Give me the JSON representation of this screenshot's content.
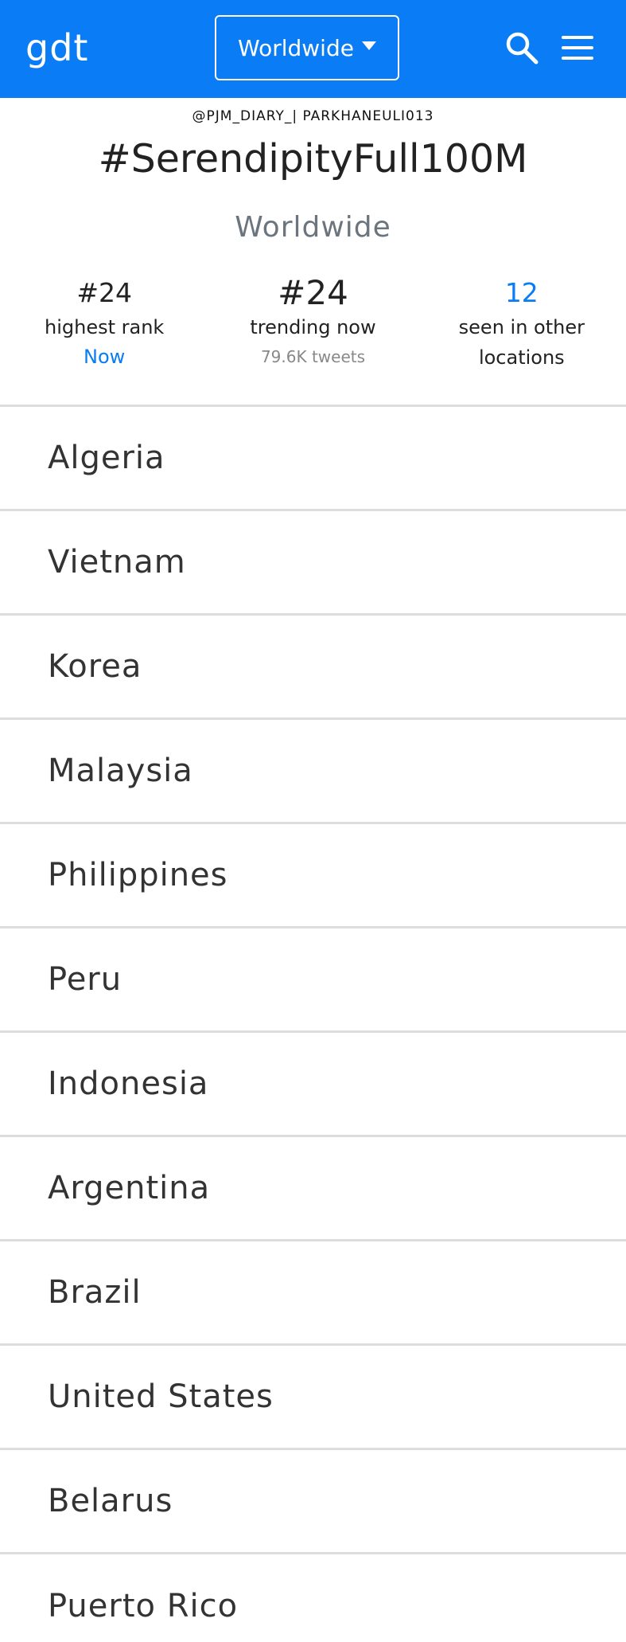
{
  "navbar": {
    "brand": "gdt",
    "location_dropdown": "Worldwide",
    "accent_color": "#0a7cf5",
    "icons": [
      "search-icon",
      "menu-icon"
    ]
  },
  "watermark": "@PJM_DIARY_| PARKHANEULI013",
  "trend": {
    "title": "#SerendipityFull100M",
    "location": "Worldwide"
  },
  "stats": {
    "highest_rank": {
      "value": "#24",
      "label": "highest rank",
      "sub": "Now"
    },
    "trending_now": {
      "value": "#24",
      "label": "trending now",
      "sub": "79.6K tweets"
    },
    "other_locations": {
      "value": "12",
      "label_line1": "seen in other",
      "label_line2": "locations"
    }
  },
  "countries": [
    "Algeria",
    "Vietnam",
    "Korea",
    "Malaysia",
    "Philippines",
    "Peru",
    "Indonesia",
    "Argentina",
    "Brazil",
    "United States",
    "Belarus",
    "Puerto Rico"
  ]
}
